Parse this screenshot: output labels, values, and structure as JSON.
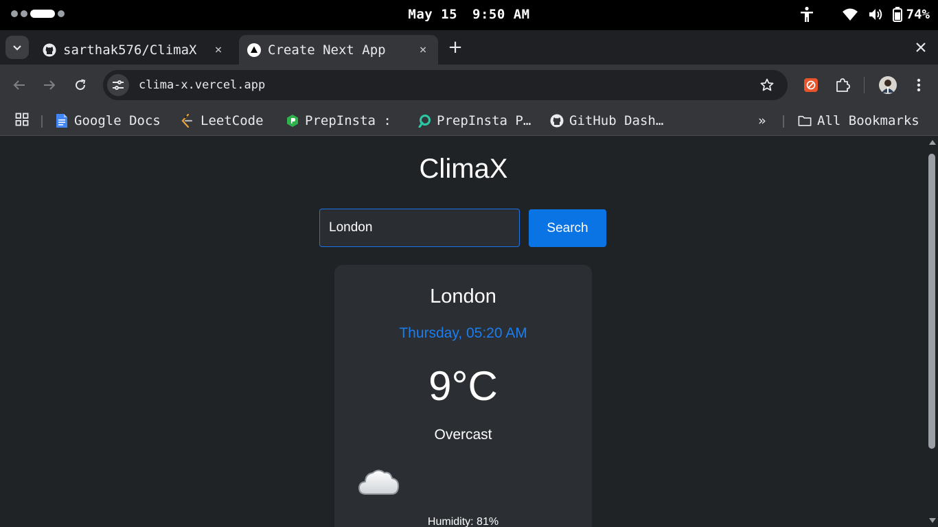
{
  "status_bar": {
    "date": "May 15",
    "time": "9:50 AM",
    "battery": "74%"
  },
  "tabs": [
    {
      "title": "sarthak576/ClimaX",
      "favicon": "github-icon",
      "active": false,
      "close": "×"
    },
    {
      "title": "Create Next App",
      "favicon": "nextjs-icon",
      "active": true,
      "close": "×"
    }
  ],
  "new_tab": "+",
  "address_bar": {
    "url": "clima-x.vercel.app"
  },
  "bookmarks": {
    "items": [
      {
        "label": "Google Docs",
        "icon": "google-docs-icon"
      },
      {
        "label": "LeetCode",
        "icon": "leetcode-icon"
      },
      {
        "label": "PrepInsta :",
        "icon": "prepinsta-icon"
      },
      {
        "label": "PrepInsta P…",
        "icon": "prepinsta-prime-icon"
      },
      {
        "label": "GitHub Dash…",
        "icon": "github-icon"
      }
    ],
    "overflow": "»",
    "all_bookmarks": "All Bookmarks"
  },
  "app": {
    "title": "ClimaX",
    "search": {
      "value": "London",
      "button": "Search"
    },
    "weather": {
      "city": "London",
      "datetime": "Thursday, 05:20 AM",
      "temperature": "9°C",
      "condition": "Overcast",
      "icon": "cloud-icon",
      "humidity": "Humidity: 81%"
    }
  },
  "colors": {
    "page_background": "#202326",
    "card_background": "#2b2e33",
    "accent": "#0b74e5",
    "datetime_text": "#1a7ef0"
  }
}
